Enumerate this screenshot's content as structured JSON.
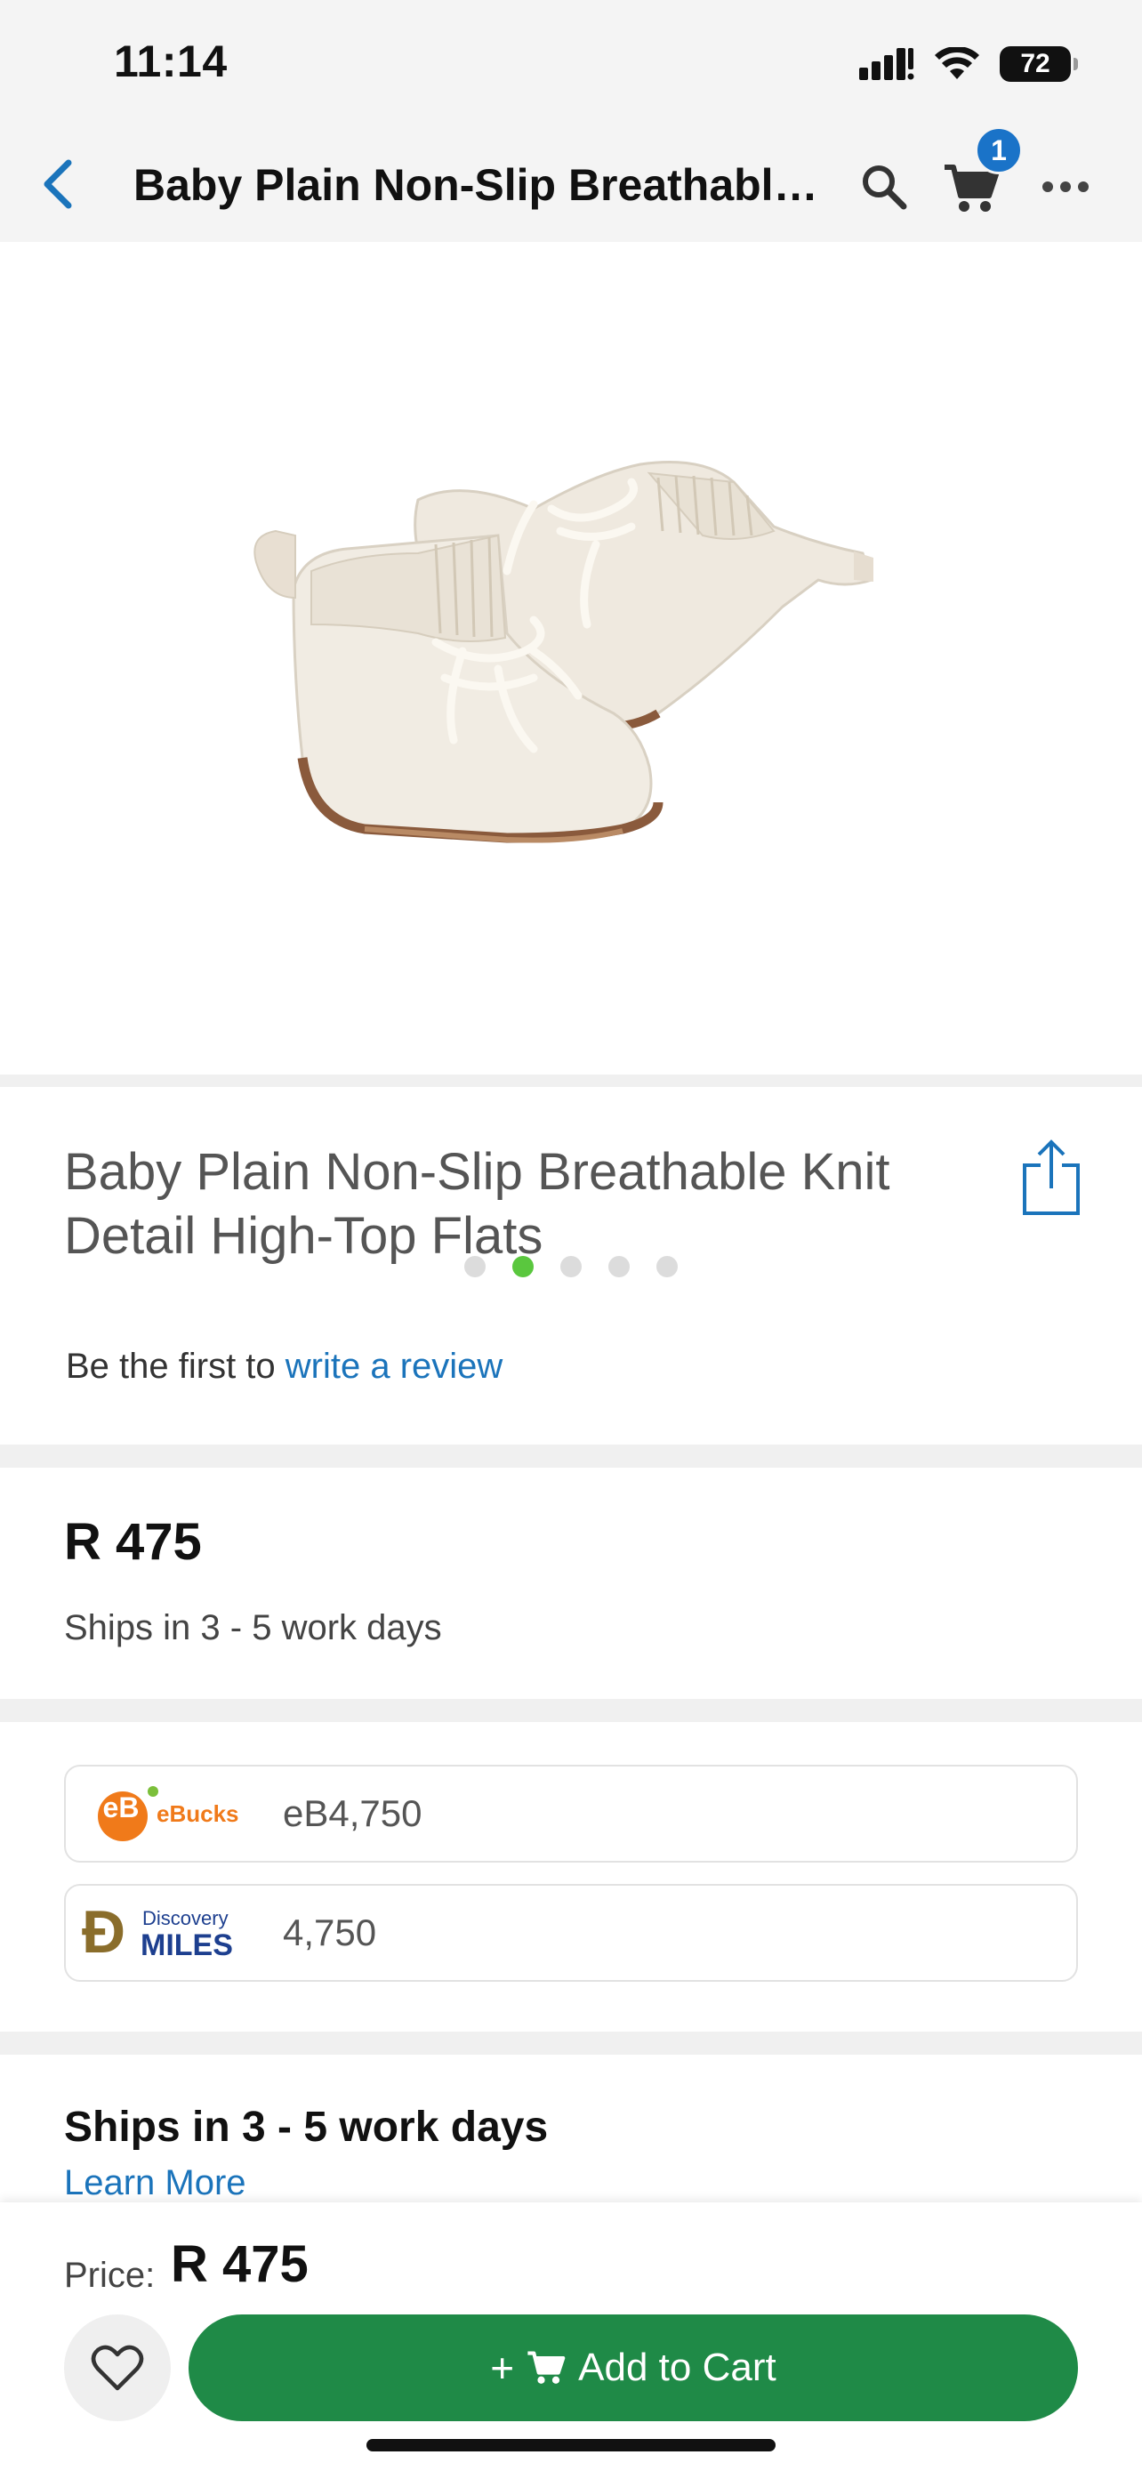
{
  "status_bar": {
    "time": "11:14",
    "battery": "72"
  },
  "nav": {
    "title": "Baby Plain Non-Slip Breathable Knit Detail High-Top Flats",
    "cart_count": "1"
  },
  "gallery": {
    "image_count": 5,
    "active_index": 1
  },
  "product": {
    "title": "Baby Plain Non-Slip Breathable Knit Detail High-Top Flats",
    "review_prefix": "Be the first to ",
    "review_link": "write a review"
  },
  "pricing": {
    "price": "R 475",
    "shipping": "Ships in 3 - 5 work days"
  },
  "rewards": {
    "ebucks": {
      "logo_text": "eBucks",
      "logo_mark": "eB",
      "value": "eB4,750"
    },
    "discovery": {
      "logo_top": "Discovery",
      "logo_bottom": "MILES",
      "logo_mark": "Đ",
      "value": "4,750"
    }
  },
  "shipping_section": {
    "heading": "Ships in 3 - 5 work days",
    "learn_more": "Learn More"
  },
  "bottom_bar": {
    "price_label": "Price:",
    "price_value": "R 475",
    "add_to_cart": "Add to Cart",
    "plus": "+"
  },
  "colors": {
    "accent_blue": "#1b74bb",
    "cart_green": "#1f8a47",
    "active_dot": "#5ac73e",
    "ebucks_orange": "#f07a1a",
    "discovery_navy": "#1d3f8f",
    "discovery_gold": "#8a6d2b"
  }
}
